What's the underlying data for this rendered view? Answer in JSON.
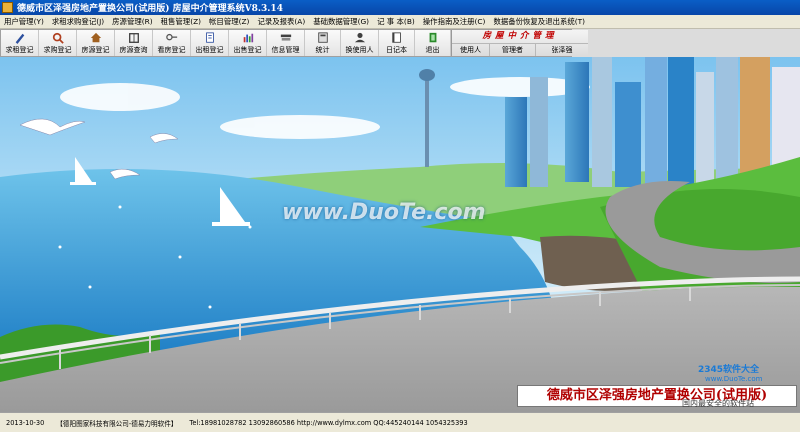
{
  "window": {
    "title": "德威市区泽强房地产置换公司(试用版) 房屋中介管理系统V8.3.14"
  },
  "menu": [
    "用户管理(Y)",
    "求租求购登记(J)",
    "房源管理(R)",
    "租售管理(Z)",
    "帐目管理(Z)",
    "记录及报表(A)",
    "基础数据管理(G)",
    "记 事 本(B)",
    "操作指南及注册(C)",
    "数据备份恢复及退出系统(T)"
  ],
  "toolbar": {
    "buttons": [
      {
        "label": "求租登记",
        "icon": "pencil-icon",
        "color": "#2c4f9e"
      },
      {
        "label": "求购登记",
        "icon": "magnifier-icon",
        "color": "#b04020"
      },
      {
        "label": "房源登记",
        "icon": "house-icon",
        "color": "#a06020"
      },
      {
        "label": "房源查询",
        "icon": "book-icon",
        "color": "#3a3a3a"
      },
      {
        "label": "看房登记",
        "icon": "key-icon",
        "color": "#555555"
      },
      {
        "label": "出租登记",
        "icon": "document-icon",
        "color": "#3050a0"
      },
      {
        "label": "出售登记",
        "icon": "chart-icon",
        "color": "#8040a0"
      },
      {
        "label": "信息管理",
        "icon": "stack-icon",
        "color": "#404040"
      },
      {
        "label": "统计",
        "icon": "calculator-icon",
        "color": "#404040"
      },
      {
        "label": "换使用人",
        "icon": "user-icon",
        "color": "#404040"
      },
      {
        "label": "日记本",
        "icon": "notebook-icon",
        "color": "#404040"
      },
      {
        "label": "退出",
        "icon": "exit-icon",
        "color": "#2a8a2a"
      }
    ]
  },
  "user_panel": {
    "brand": "房屋中介管理",
    "user_label": "使用人",
    "role": "管理者",
    "name": "张泽强"
  },
  "caption": "德威市区泽强房地产置换公司(试用版)",
  "watermarks": {
    "center": "www.DuoTe.com",
    "logo": "2345软件大全",
    "logo_url": "www.DuoTe.com",
    "bottom": "国内最安全的软件站"
  },
  "statusbar": {
    "date": "2013-10-30",
    "vendor": "【德阳图家科技有限公司-德易力明软件】",
    "tel": "Tel:18981028782 13092860586 http://www.dylmx.com QQ:445240144 1054325393"
  }
}
